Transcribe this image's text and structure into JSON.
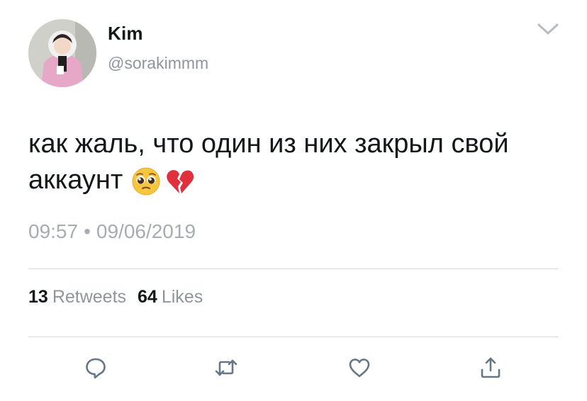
{
  "author": {
    "display_name": "Kim",
    "handle": "@sorakimmm"
  },
  "tweet": {
    "text": "как жаль, что один из них закрыл свой аккаунт",
    "emojis": [
      "pleading-face",
      "broken-heart"
    ]
  },
  "timestamp": {
    "time": "09:57",
    "separator": "•",
    "date": "09/06/2019"
  },
  "stats": {
    "retweets_count": "13",
    "retweets_label": "Retweets",
    "likes_count": "64",
    "likes_label": "Likes"
  },
  "actions": [
    "reply-icon",
    "retweet-icon",
    "like-icon",
    "share-icon"
  ],
  "colors": {
    "text_primary": "#14171a",
    "text_secondary": "#8e959c",
    "icon": "#657786",
    "divider": "#d7dbdf"
  }
}
